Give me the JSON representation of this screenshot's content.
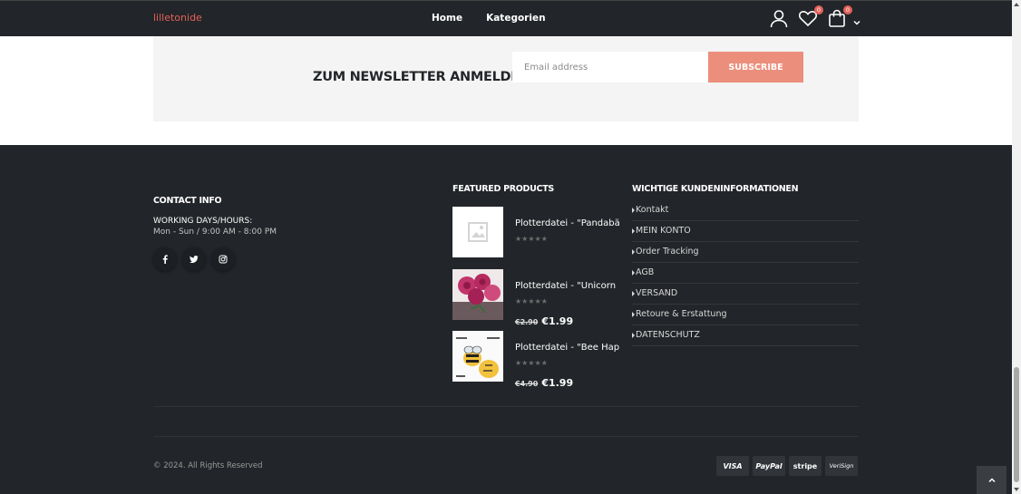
{
  "header": {
    "logo": "lilletonide",
    "nav": [
      "Home",
      "Kategorien"
    ],
    "wishlist_count": "0",
    "cart_count": "0"
  },
  "newsletter": {
    "title": "ZUM NEWSLETTER ANMELDEN",
    "placeholder": "Email address",
    "button": "SUBSCRIBE"
  },
  "footer": {
    "contact": {
      "title": "CONTACT INFO",
      "label": "WORKING DAYS/HOURS:",
      "hours": "Mon - Sun / 9:00 AM - 8:00 PM",
      "social": [
        "facebook-icon",
        "twitter-icon",
        "instagram-icon"
      ]
    },
    "featured": {
      "title": "FEATURED PRODUCTS",
      "products": [
        {
          "name": "Plotterdatei - \"Pandabär\"",
          "rating": 0,
          "old_price": "",
          "price": ""
        },
        {
          "name": "Plotterdatei - \"Unicorn love\"",
          "rating": 0,
          "old_price": "€2.90",
          "price": "€1.99"
        },
        {
          "name": "Plotterdatei - \"Bee Happy\"",
          "rating": 0,
          "old_price": "€4.90",
          "price": "€1.99"
        }
      ]
    },
    "info": {
      "title": "WICHTIGE KUNDENINFORMATIONEN",
      "links": [
        "Kontakt",
        "MEIN KONTO",
        "Order Tracking",
        "AGB",
        "VERSAND",
        "Retoure & Erstattung",
        "DATENSCHUTZ"
      ]
    },
    "copyright": "© 2024. All Rights Reserved",
    "payments": [
      "VISA",
      "PayPal",
      "stripe",
      "VeriSign"
    ]
  },
  "colors": {
    "accent": "#e36159",
    "button": "#ec8e7c",
    "dark": "#222529"
  }
}
